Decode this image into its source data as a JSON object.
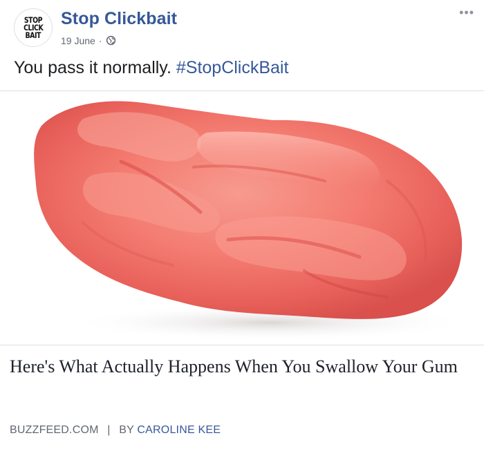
{
  "post": {
    "page_name": "Stop Clickbait",
    "avatar_lines": [
      "STOP",
      "CLICK",
      "BAIT"
    ],
    "date": "19 June",
    "date_separator": "·",
    "privacy_icon": "globe-icon",
    "more_icon": "more-options-icon",
    "text": "You pass it normally.",
    "hashtag": "#StopClickBait"
  },
  "link": {
    "image_description_icon": "chewed-gum-photo",
    "title": "Here's What Actually Happens When You Swallow Your Gum",
    "domain": "BUZZFEED.COM",
    "separator": "|",
    "by_label": "BY",
    "author": "CAROLINE KEE"
  },
  "colors": {
    "link_blue": "#365899",
    "meta_gray": "#616770",
    "border": "#dddfe2",
    "gum_pink": "#f37a72"
  }
}
